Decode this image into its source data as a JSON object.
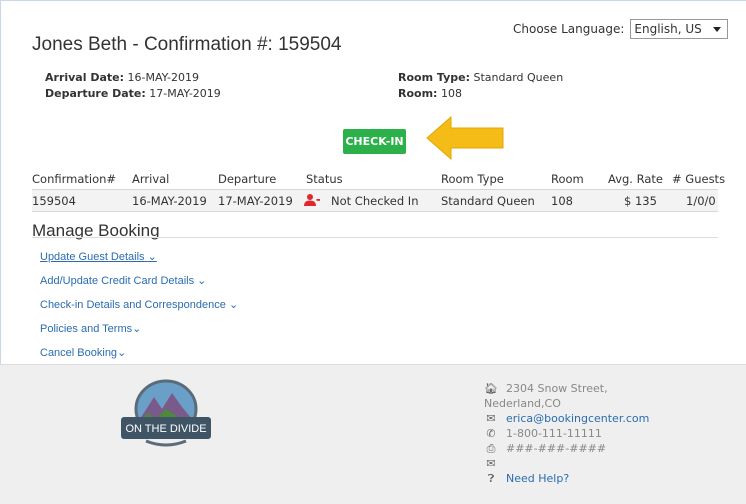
{
  "language": {
    "label": "Choose Language:",
    "selected": "English, US"
  },
  "page_title": "Jones Beth - Confirmation #: 159504",
  "info": {
    "arrival_label": "Arrival Date:",
    "arrival_value": "16-MAY-2019",
    "departure_label": "Departure Date:",
    "departure_value": "17-MAY-2019",
    "roomtype_label": "Room Type:",
    "roomtype_value": "Standard Queen",
    "room_label": "Room:",
    "room_value": "108"
  },
  "checkin_label": "CHECK-IN",
  "table": {
    "headers": [
      "Confirmation#",
      "Arrival",
      "Departure",
      "Status",
      "Room Type",
      "Room",
      "Avg. Rate",
      "# Guests"
    ],
    "row": [
      "159504",
      "16-MAY-2019",
      "17-MAY-2019",
      "Not Checked In",
      "Standard Queen",
      "108",
      "$ 135",
      "1/0/0"
    ]
  },
  "manage": {
    "title": "Manage Booking",
    "links": [
      "Update Guest Details",
      "Add/Update Credit Card Details",
      "Check-in Details and Correspondence",
      "Policies and Terms",
      "Cancel Booking"
    ]
  },
  "footer": {
    "logo_text": "ON THE DIVIDE",
    "address_1": "2304 Snow Street,",
    "address_2": "Nederland,CO",
    "email": "erica@bookingcenter.com",
    "phone": "1-800-111-11111",
    "fax": "###-###-####",
    "help": "Need Help?"
  },
  "colors": {
    "accent_green": "#2bb04a",
    "arrow_yellow": "#f5bb16",
    "link_blue": "#2b6cb0",
    "status_red": "#e0282c"
  }
}
